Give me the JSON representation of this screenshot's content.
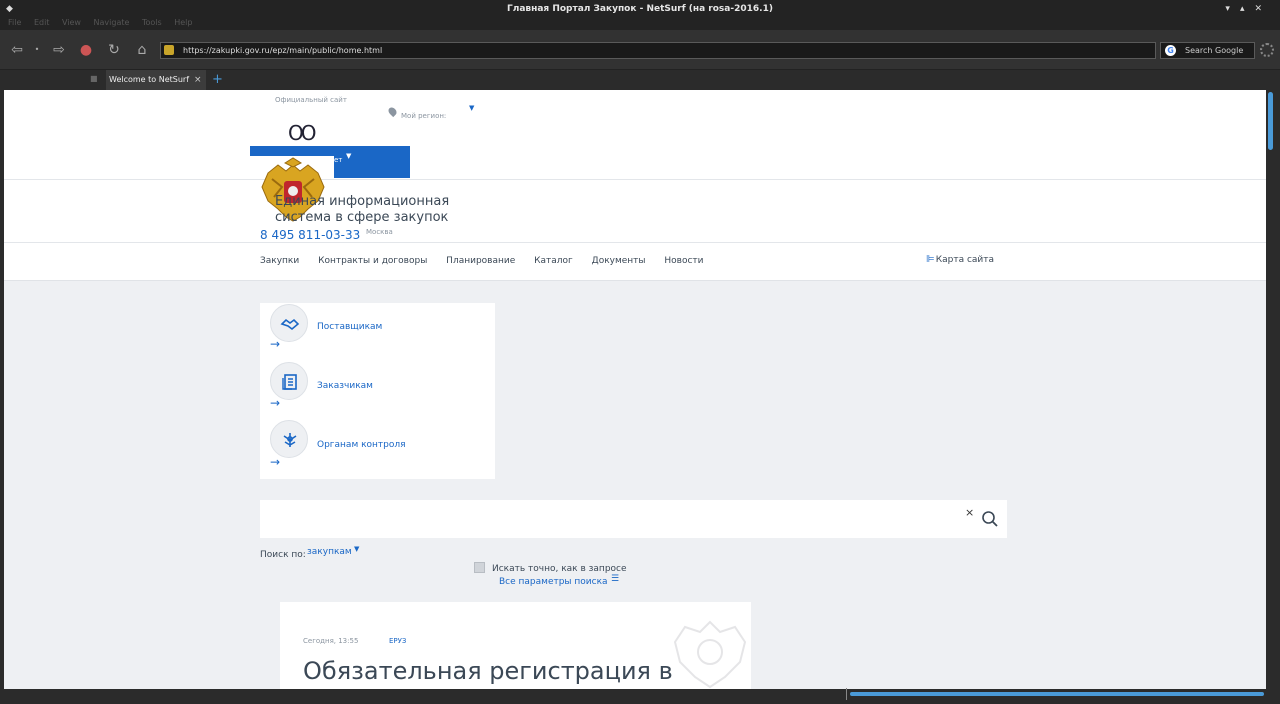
{
  "window": {
    "title": "Главная Портал Закупок - NetSurf (на rosa-2016.1)",
    "menu": [
      "File",
      "Edit",
      "View",
      "Navigate",
      "Tools",
      "Help"
    ]
  },
  "toolbar": {
    "url": "https://zakupki.gov.ru/epz/main/public/home.html",
    "search_placeholder": "Search Google"
  },
  "tabs": [
    {
      "label": "Welcome to NetSurf",
      "active": true
    }
  ],
  "header": {
    "official_site": "Официальный сайт",
    "region": "Мой регион:",
    "login_label": "ет",
    "eis_line1": "Единая информационная",
    "eis_line2": "система в сфере закупок",
    "phone": "8 495 811-03-33",
    "city": "Москва"
  },
  "nav": {
    "items": [
      "Закупки",
      "Контракты и договоры",
      "Планирование",
      "Каталог",
      "Документы",
      "Новости"
    ],
    "sitemap": "Карта сайта"
  },
  "roles": [
    {
      "label": "Поставщикам",
      "icon": "handshake-icon"
    },
    {
      "label": "Заказчикам",
      "icon": "documents-icon"
    },
    {
      "label": "Органам контроля",
      "icon": "emblem-icon"
    }
  ],
  "search": {
    "clear": "×",
    "by_label": "Поиск по:",
    "by_value": "закупкам",
    "exact_label": "Искать точно, как в запросе",
    "all_params": "Все параметры поиска"
  },
  "news": {
    "date": "Сегодня, 13:55",
    "tag": "ЕРУЗ",
    "title": "Обязательная регистрация в"
  },
  "colors": {
    "accent": "#1a67c6",
    "text": "#3b4856",
    "muted": "#8b95a0",
    "page_bg": "#eef0f3",
    "chrome": "#323232",
    "scroll_thumb": "#4a9ad8"
  }
}
